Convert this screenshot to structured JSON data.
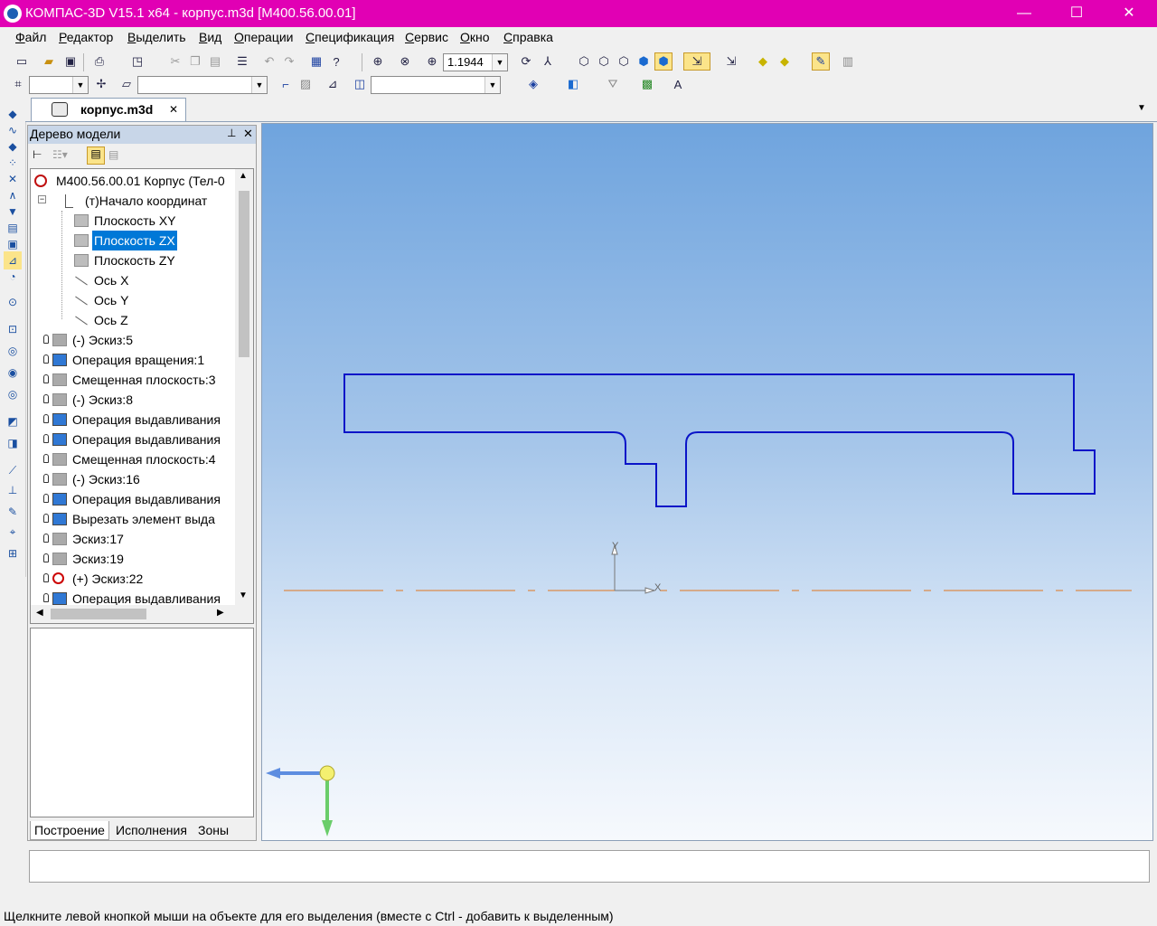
{
  "window": {
    "title": "КОМПАС-3D V15.1 x64 - корпус.m3d [М400.56.00.01]",
    "controls": {
      "minimize": "—",
      "maximize": "☐",
      "close": "✕"
    }
  },
  "menu": [
    "Файл",
    "Редактор",
    "Выделить",
    "Вид",
    "Операции",
    "Спецификация",
    "Сервис",
    "Окно",
    "Справка"
  ],
  "toolbar": {
    "zoom_value": "1.1944",
    "combo1_value": "",
    "combo2_value": "",
    "combo3_value": ""
  },
  "document_tab": {
    "label": "корпус.m3d",
    "close": "✕"
  },
  "tree_panel": {
    "title": "Дерево модели",
    "pin": "⊥",
    "close": "✕",
    "root": "М400.56.00.01 Корпус (Тел-0",
    "items": [
      {
        "label": "(т)Начало координат",
        "indent": 1,
        "icon": "origin-icon"
      },
      {
        "label": "Плоскость XY",
        "indent": 2,
        "icon": "plane-icon"
      },
      {
        "label": "Плоскость ZX",
        "indent": 2,
        "icon": "plane-icon",
        "selected": true
      },
      {
        "label": "Плоскость ZY",
        "indent": 2,
        "icon": "plane-icon"
      },
      {
        "label": "Ось X",
        "indent": 2,
        "icon": "axis-icon"
      },
      {
        "label": "Ось Y",
        "indent": 2,
        "icon": "axis-icon"
      },
      {
        "label": "Ось Z",
        "indent": 2,
        "icon": "axis-icon"
      },
      {
        "label": "(-) Эскиз:5",
        "indent": 0,
        "icon": "sketch-icon"
      },
      {
        "label": "Операция вращения:1",
        "indent": 0,
        "icon": "revolve-icon"
      },
      {
        "label": "Смещенная плоскость:3",
        "indent": 0,
        "icon": "offset-plane-icon"
      },
      {
        "label": "(-) Эскиз:8",
        "indent": 0,
        "icon": "sketch-icon"
      },
      {
        "label": "Операция выдавливания",
        "indent": 0,
        "icon": "extrude-icon"
      },
      {
        "label": "Операция выдавливания",
        "indent": 0,
        "icon": "extrude-icon"
      },
      {
        "label": "Смещенная плоскость:4",
        "indent": 0,
        "icon": "offset-plane-icon"
      },
      {
        "label": "(-) Эскиз:16",
        "indent": 0,
        "icon": "sketch-icon"
      },
      {
        "label": "Операция выдавливания",
        "indent": 0,
        "icon": "extrude-icon"
      },
      {
        "label": "Вырезать элемент выда",
        "indent": 0,
        "icon": "cut-extrude-icon"
      },
      {
        "label": "Эскиз:17",
        "indent": 0,
        "icon": "sketch-icon"
      },
      {
        "label": "Эскиз:19",
        "indent": 0,
        "icon": "sketch-icon"
      },
      {
        "label": "(+) Эскиз:22",
        "indent": 0,
        "icon": "sketch-error-icon"
      },
      {
        "label": "Операция выдавливания",
        "indent": 0,
        "icon": "extrude-icon"
      }
    ],
    "bottom_tabs": [
      "Построение",
      "Исполнения",
      "Зоны"
    ]
  },
  "viewport": {
    "axis_labels": {
      "x": "X",
      "y": "Y"
    },
    "sketch_color": "#0a14c8",
    "centerline_color": "#e07820"
  },
  "command_bar": {
    "text": ""
  },
  "status": "Щелкните левой кнопкой мыши на объекте для его выделения (вместе с Ctrl - добавить к выделенным)"
}
